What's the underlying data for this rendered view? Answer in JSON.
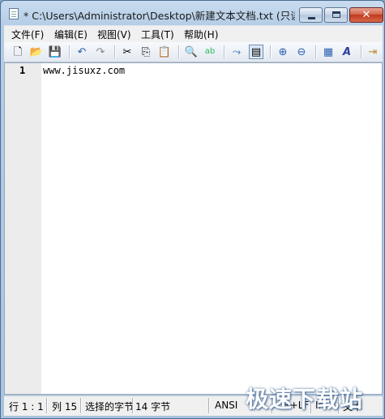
{
  "window": {
    "title": "* C:\\Users\\Administrator\\Desktop\\新建文本文档.txt (只读..."
  },
  "menu": {
    "items": [
      {
        "label": "文件(F)"
      },
      {
        "label": "编辑(E)"
      },
      {
        "label": "视图(V)"
      },
      {
        "label": "工具(T)"
      },
      {
        "label": "帮助(H)"
      }
    ]
  },
  "toolbar": {
    "buttons": [
      {
        "name": "new-icon",
        "glyph": "🗋"
      },
      {
        "name": "open-icon",
        "glyph": "📂"
      },
      {
        "name": "save-icon",
        "glyph": "💾"
      },
      {
        "name": "undo-icon",
        "glyph": "↶"
      },
      {
        "name": "redo-icon",
        "glyph": "↷"
      },
      {
        "name": "cut-icon",
        "glyph": "✂"
      },
      {
        "name": "copy-icon",
        "glyph": "⎘"
      },
      {
        "name": "paste-icon",
        "glyph": "📋"
      },
      {
        "name": "find-icon",
        "glyph": "🔍"
      },
      {
        "name": "replace-icon",
        "glyph": "ab"
      },
      {
        "name": "goto-icon",
        "glyph": "⤳"
      },
      {
        "name": "wordwrap-icon",
        "glyph": "▤"
      },
      {
        "name": "zoom-in-icon",
        "glyph": "⊕"
      },
      {
        "name": "zoom-out-icon",
        "glyph": "⊖"
      },
      {
        "name": "settings-icon",
        "glyph": "▦"
      },
      {
        "name": "font-icon",
        "glyph": "A"
      },
      {
        "name": "exit-icon",
        "glyph": "⇥"
      }
    ]
  },
  "editor": {
    "line_number": "1",
    "text": "www.jisuxz.com"
  },
  "statusbar": {
    "line_col": "行 1 : 1",
    "col": "列 15",
    "selection": "选择的字节",
    "bytes": "14 字节",
    "encoding": "ANSI",
    "line_ending": "CR+LF",
    "mode": "INS",
    "type": "文本"
  },
  "watermark": "极速下载站",
  "colors": {
    "titlebar": "#c9dcef",
    "close_button": "#c0391c",
    "gutter": "#ececec"
  }
}
